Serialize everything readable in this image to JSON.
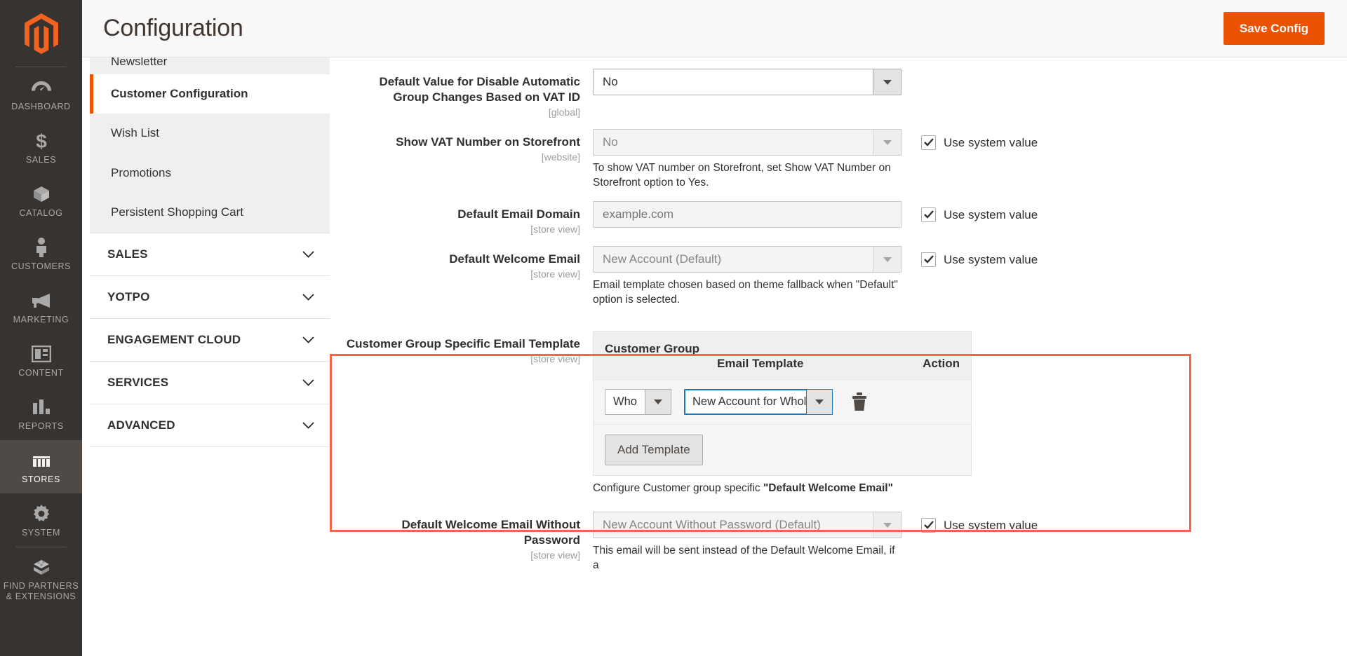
{
  "admin_nav": {
    "logo_name": "magento-logo",
    "items": [
      {
        "label": "DASHBOARD",
        "icon": "dashboard-gauge-icon",
        "active": false,
        "divided": false
      },
      {
        "label": "SALES",
        "icon": "dollar-sign-icon",
        "active": false,
        "divided": false
      },
      {
        "label": "CATALOG",
        "icon": "box-icon",
        "active": false,
        "divided": false
      },
      {
        "label": "CUSTOMERS",
        "icon": "person-icon",
        "active": false,
        "divided": false
      },
      {
        "label": "MARKETING",
        "icon": "megaphone-icon",
        "active": false,
        "divided": false
      },
      {
        "label": "CONTENT",
        "icon": "layout-page-icon",
        "active": false,
        "divided": false
      },
      {
        "label": "REPORTS",
        "icon": "bar-chart-icon",
        "active": false,
        "divided": false
      },
      {
        "label": "STORES",
        "icon": "storefront-icon",
        "active": true,
        "divided": false
      },
      {
        "label": "SYSTEM",
        "icon": "gear-icon",
        "active": false,
        "divided": false
      },
      {
        "label": "FIND PARTNERS\n& EXTENSIONS",
        "icon": "blocks-icon",
        "active": false,
        "divided": true
      }
    ]
  },
  "header": {
    "title": "Configuration",
    "save_label": "Save Config",
    "accent_color": "#eb5202"
  },
  "config_nav": {
    "items": [
      {
        "label": "Newsletter",
        "current": false,
        "clipped": true
      },
      {
        "label": "Customer Configuration",
        "current": true,
        "clipped": false
      },
      {
        "label": "Wish List",
        "current": false,
        "clipped": false
      },
      {
        "label": "Promotions",
        "current": false,
        "clipped": false
      },
      {
        "label": "Persistent Shopping Cart",
        "current": false,
        "clipped": false
      }
    ],
    "sections": [
      {
        "label": "SALES",
        "icon": "chevron-down-icon"
      },
      {
        "label": "YOTPO",
        "icon": "chevron-down-icon"
      },
      {
        "label": "ENGAGEMENT CLOUD",
        "icon": "chevron-down-icon"
      },
      {
        "label": "SERVICES",
        "icon": "chevron-down-icon"
      },
      {
        "label": "ADVANCED",
        "icon": "chevron-down-icon"
      }
    ]
  },
  "form": {
    "use_system_value_label": "Use system value",
    "fields": {
      "vat_auto_group": {
        "label": "Default Value for Disable Automatic Group Changes Based on VAT ID",
        "scope": "[global]",
        "value": "No"
      },
      "show_vat_storefront": {
        "label": "Show VAT Number on Storefront",
        "scope": "[website]",
        "value": "No",
        "note": "To show VAT number on Storefront, set Show VAT Number on Storefront option to Yes.",
        "use_system_value": true
      },
      "default_email_domain": {
        "label": "Default Email Domain",
        "scope": "[store view]",
        "placeholder": "example.com",
        "value": "",
        "use_system_value": true
      },
      "default_welcome_email": {
        "label": "Default Welcome Email",
        "scope": "[store view]",
        "value": "New Account (Default)",
        "note": "Email template chosen based on theme fallback when \"Default\" option is selected.",
        "use_system_value": true
      },
      "customer_group_specific": {
        "label": "Customer Group Specific Email Template",
        "scope": "[store view]",
        "columns": [
          "Customer Group",
          "Email Template",
          "Action"
        ],
        "rows": [
          {
            "group": "Who",
            "template": "New Account for Whol",
            "delete_icon": "trash-icon"
          }
        ],
        "add_label": "Add Template",
        "note_prefix": "Configure Customer group specific ",
        "note_strong": "\"Default Welcome Email\"",
        "highlight_color": "#f2654c"
      },
      "welcome_email_no_password": {
        "label": "Default Welcome Email Without Password",
        "scope": "[store view]",
        "value": "New Account Without Password (Default)",
        "note": "This email will be sent instead of the Default Welcome Email, if a",
        "use_system_value": true
      }
    }
  }
}
